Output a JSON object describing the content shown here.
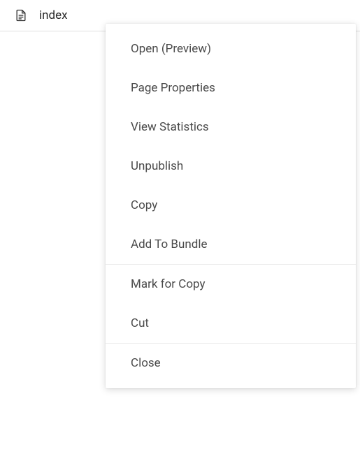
{
  "file": {
    "name": "index"
  },
  "contextMenu": {
    "groups": [
      [
        {
          "label": "Open (Preview)",
          "name": "menu-item-open-preview"
        },
        {
          "label": "Page Properties",
          "name": "menu-item-page-properties"
        },
        {
          "label": "View Statistics",
          "name": "menu-item-view-statistics"
        },
        {
          "label": "Unpublish",
          "name": "menu-item-unpublish"
        },
        {
          "label": "Copy",
          "name": "menu-item-copy"
        },
        {
          "label": "Add To Bundle",
          "name": "menu-item-add-to-bundle"
        }
      ],
      [
        {
          "label": "Mark for Copy",
          "name": "menu-item-mark-for-copy"
        },
        {
          "label": "Cut",
          "name": "menu-item-cut"
        }
      ],
      [
        {
          "label": "Close",
          "name": "menu-item-close"
        }
      ]
    ]
  }
}
